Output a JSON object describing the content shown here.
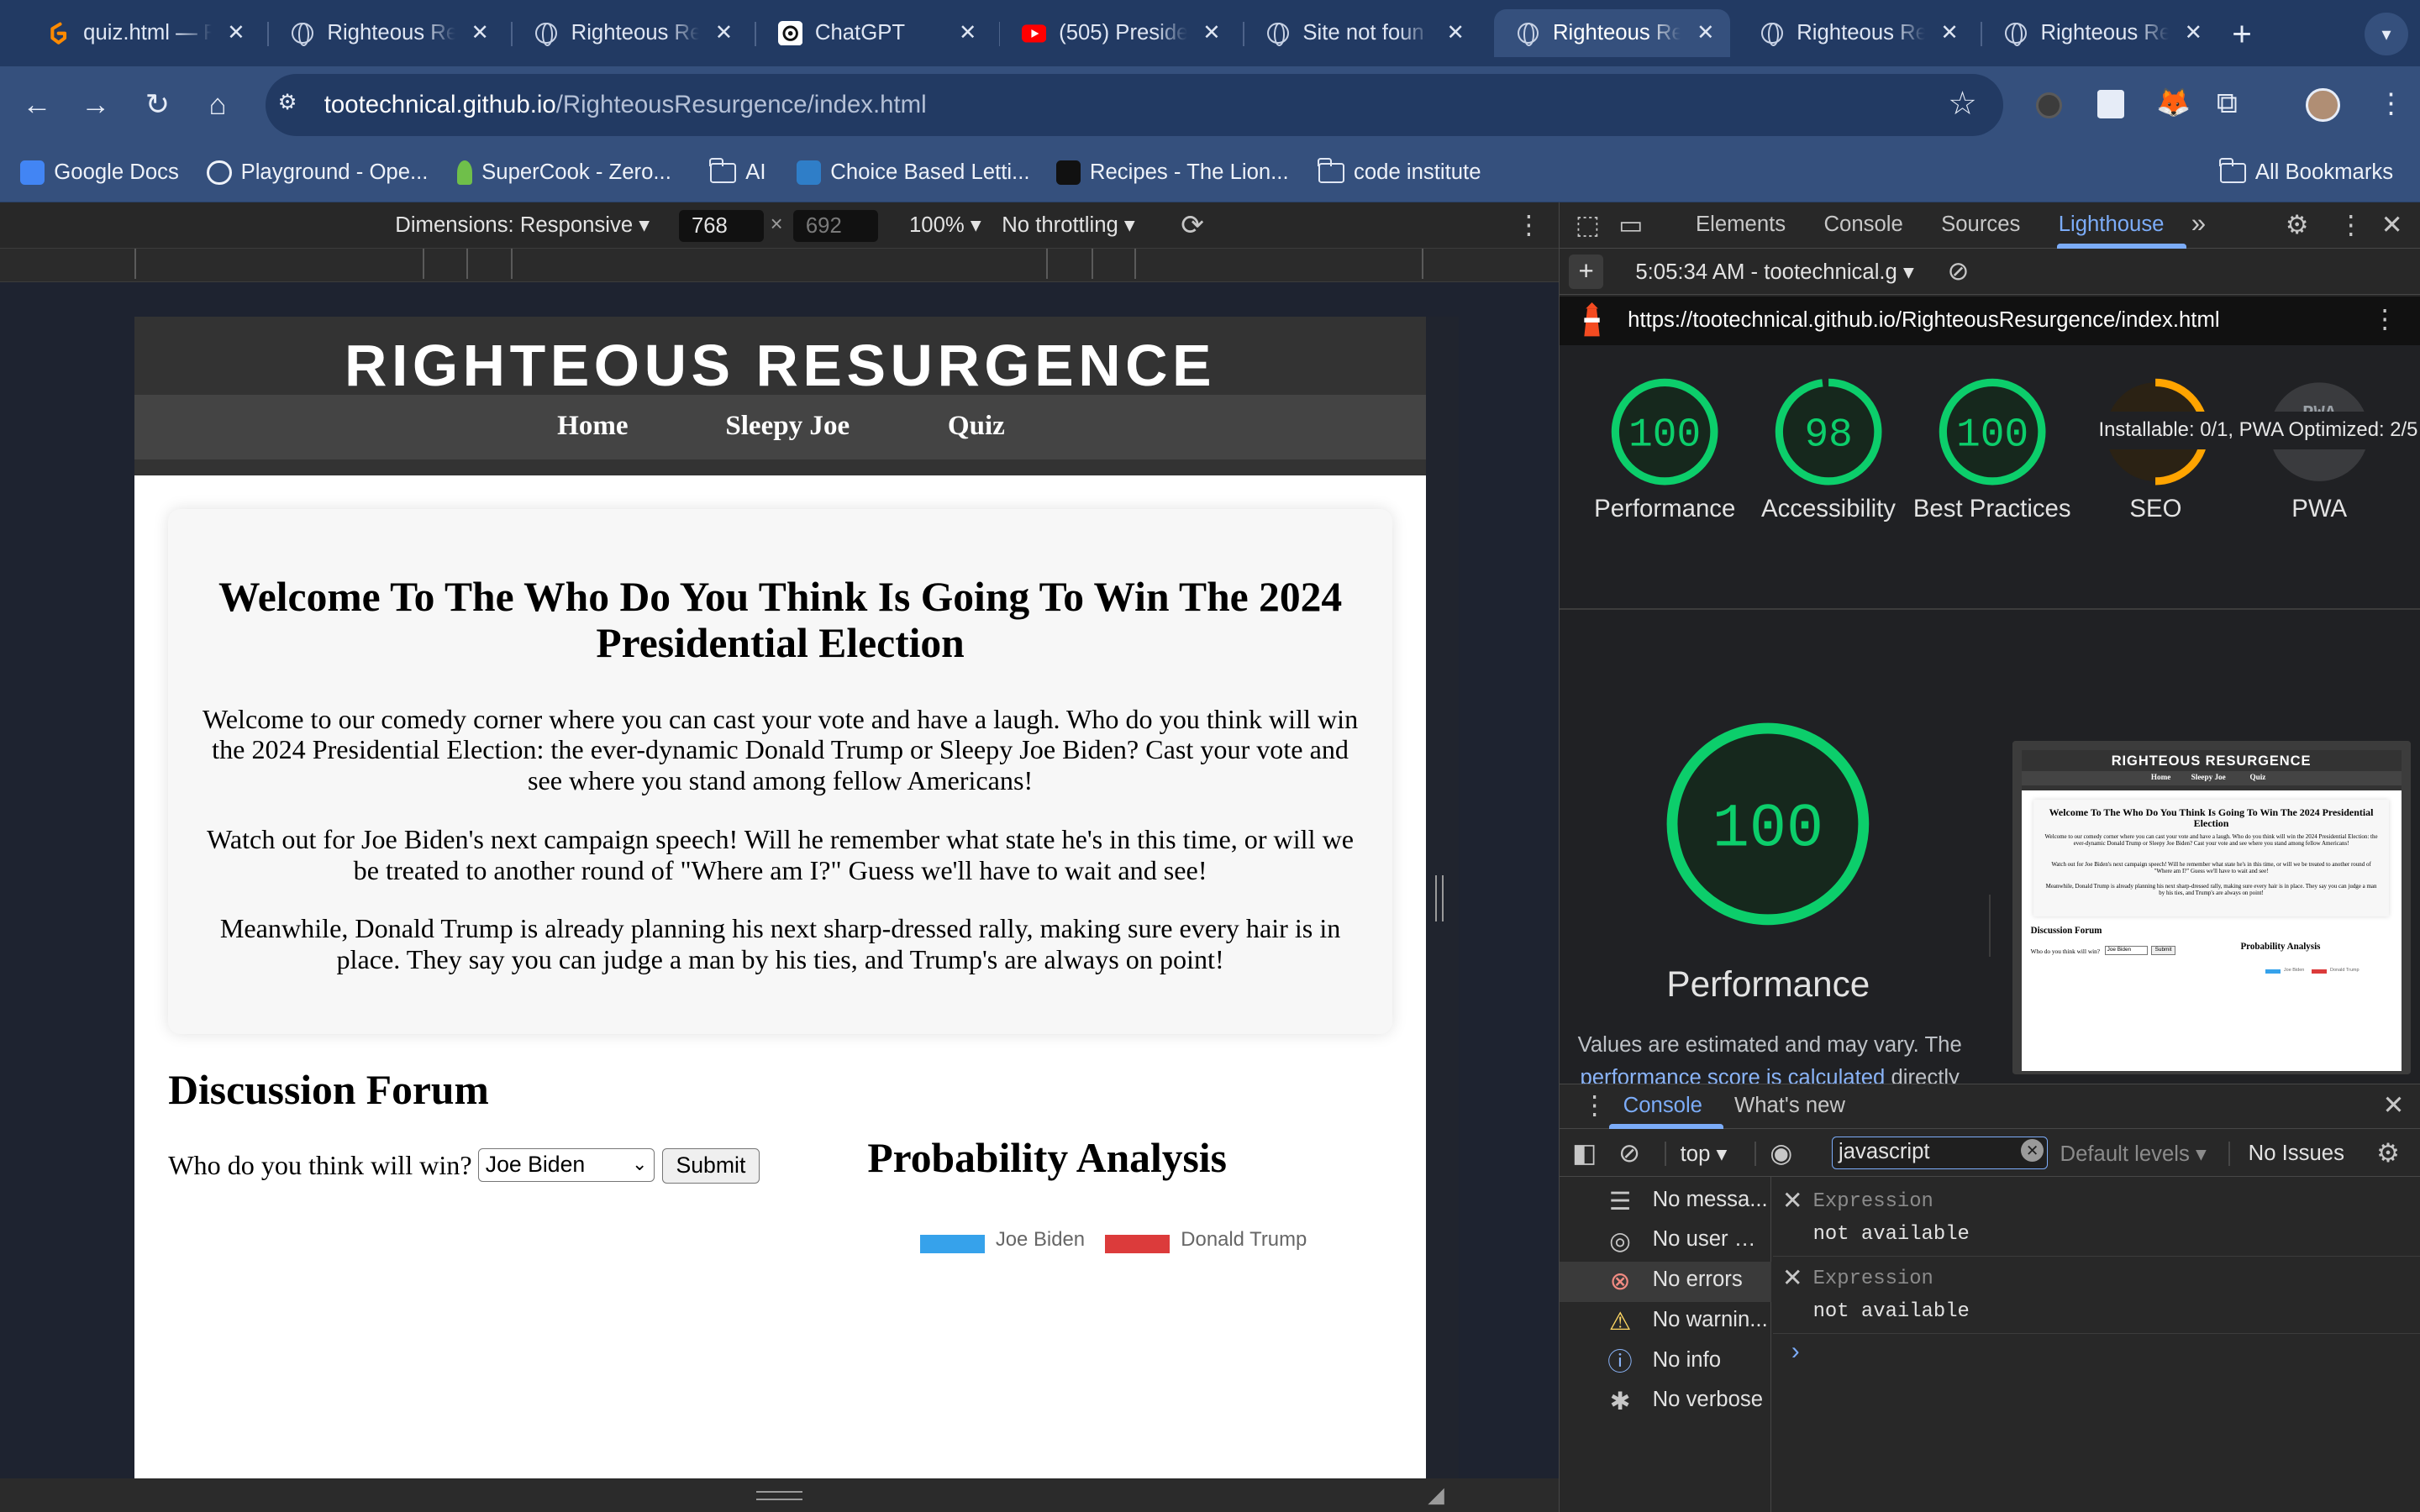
{
  "browser": {
    "tabs": [
      {
        "title": "quiz.html — F",
        "favicon": "gitpod-icon"
      },
      {
        "title": "Righteous Re",
        "favicon": "globe-icon"
      },
      {
        "title": "Righteous Re",
        "favicon": "globe-icon"
      },
      {
        "title": "ChatGPT",
        "favicon": "chatgpt-icon"
      },
      {
        "title": "(505) Preside",
        "favicon": "youtube-icon"
      },
      {
        "title": "Site not foun",
        "favicon": "globe-icon"
      },
      {
        "title": "Righteous Re",
        "favicon": "globe-icon",
        "active": true
      },
      {
        "title": "Righteous Re",
        "favicon": "globe-icon"
      },
      {
        "title": "Righteous Re",
        "favicon": "globe-icon"
      }
    ],
    "new_tab": "+",
    "url_host": "tootechnical.github.io",
    "url_path": "/RighteousResurgence/index.html",
    "bookmarks": [
      {
        "label": "Google Docs",
        "icon": "google-docs-icon"
      },
      {
        "label": "Playground - Ope...",
        "icon": "openai-icon"
      },
      {
        "label": "SuperCook - Zero...",
        "icon": "supercook-icon"
      },
      {
        "label": "AI",
        "icon": "folder-icon"
      },
      {
        "label": "Choice Based Letti...",
        "icon": "choice-icon"
      },
      {
        "label": "Recipes - The Lion...",
        "icon": "lion-icon"
      },
      {
        "label": "code institute",
        "icon": "folder-icon"
      }
    ],
    "all_bookmarks": "All Bookmarks"
  },
  "device_toolbar": {
    "dimensions": "Dimensions: Responsive ▾",
    "width": "768",
    "times": "×",
    "height": "692",
    "zoom": "100% ▾",
    "throttling": "No throttling ▾"
  },
  "site": {
    "title": "RIGHTEOUS RESURGENCE",
    "nav": [
      "Home",
      "Sleepy Joe",
      "Quiz"
    ],
    "welcome_title": "Welcome To The Who Do You Think Is Going To Win The 2024 Presidential Election",
    "paragraphs": [
      "Welcome to our comedy corner where you can cast your vote and have a laugh. Who do you think will win the 2024 Presidential Election: the ever-dynamic Donald Trump or Sleepy Joe Biden? Cast your vote and see where you stand among fellow Americans!",
      "Watch out for Joe Biden's next campaign speech! Will he remember what state he's in this time, or will we be treated to another round of \"Where am I?\" Guess we'll have to wait and see!",
      "Meanwhile, Donald Trump is already planning his next sharp-dressed rally, making sure every hair is in place. They say you can judge a man by his ties, and Trump's are always on point!"
    ],
    "forum_title": "Discussion Forum",
    "vote_label": "Who do you think will win?",
    "vote_selected": "Joe Biden",
    "submit_label": "Submit",
    "prob_title": "Probability Analysis",
    "legend": [
      {
        "label": "Joe Biden",
        "color": "#36a2eb"
      },
      {
        "label": "Donald Trump",
        "color": "#dc3b3b"
      }
    ]
  },
  "devtools": {
    "tabs": [
      "Elements",
      "Console",
      "Sources",
      "Lighthouse"
    ],
    "more": "»",
    "report_select": "5:05:34 AM - tootechnical.g ▾",
    "report_url": "https://tootechnical.github.io/RighteousResurgence/index.html",
    "scores": [
      {
        "label": "Performance",
        "score": 100,
        "fraction": 1.0,
        "color": "#0cce6b"
      },
      {
        "label": "Accessibility",
        "score": 98,
        "fraction": 0.98,
        "color": "#0cce6b"
      },
      {
        "label": "Best Practices",
        "score": 100,
        "fraction": 1.0,
        "color": "#0cce6b"
      },
      {
        "label": "SEO",
        "score": "",
        "fraction": 0.5,
        "color": "#ffa400"
      },
      {
        "label": "PWA",
        "score": "PWA",
        "fraction": 0,
        "color": "#5f6368"
      }
    ],
    "tooltip": "Installable: 0/1, PWA Optimized: 2/5",
    "big_score": "100",
    "big_label": "Performance",
    "note_a": "Values are estimated and may vary. The",
    "note_link": "performance score is calculated",
    "note_b": "directly from",
    "thumb": {
      "title": "RIGHTEOUS RESURGENCE",
      "nav": [
        "Home",
        "Sleepy Joe",
        "Quiz"
      ],
      "heading": "Welcome To The Who Do You Think Is Going To Win The 2024 Presidential Election",
      "p1": "Welcome to our comedy corner where you can cast your vote and have a laugh. Who do you think will win the 2024 Presidential Election: the ever-dynamic Donald Trump or Sleepy Joe Biden? Cast your vote and see where you stand among fellow Americans!",
      "p2": "Watch out for Joe Biden's next campaign speech! Will he remember what state he's in this time, or will we be treated to another round of \"Where am I?\" Guess we'll have to wait and see!",
      "p3": "Meanwhile, Donald Trump is already planning his next sharp-dressed rally, making sure every hair is in place. They say you can judge a man by his ties, and Trump's are always on point!",
      "forum": "Discussion Forum",
      "vote": "Who do you think will win?",
      "select": "Joe Biden",
      "submit": "Submit",
      "prob": "Probability Analysis",
      "legend_a": "Joe Biden",
      "legend_b": "Donald Trump"
    },
    "drawer_tabs": [
      "Console",
      "What's new"
    ],
    "context": "top ▾",
    "filter": "javascript",
    "levels": "Default levels ▾",
    "issues": "No Issues",
    "sidebar": [
      {
        "label": "No messa...",
        "icon": "list-icon"
      },
      {
        "label": "No user m...",
        "icon": "user-icon"
      },
      {
        "label": "No errors",
        "icon": "error-icon"
      },
      {
        "label": "No warnin...",
        "icon": "warning-icon"
      },
      {
        "label": "No info",
        "icon": "info-icon"
      },
      {
        "label": "No verbose",
        "icon": "bug-icon"
      }
    ],
    "expressions": [
      {
        "name": "Expression",
        "value": "not available"
      },
      {
        "name": "Expression",
        "value": "not available"
      }
    ],
    "prompt": "›"
  }
}
